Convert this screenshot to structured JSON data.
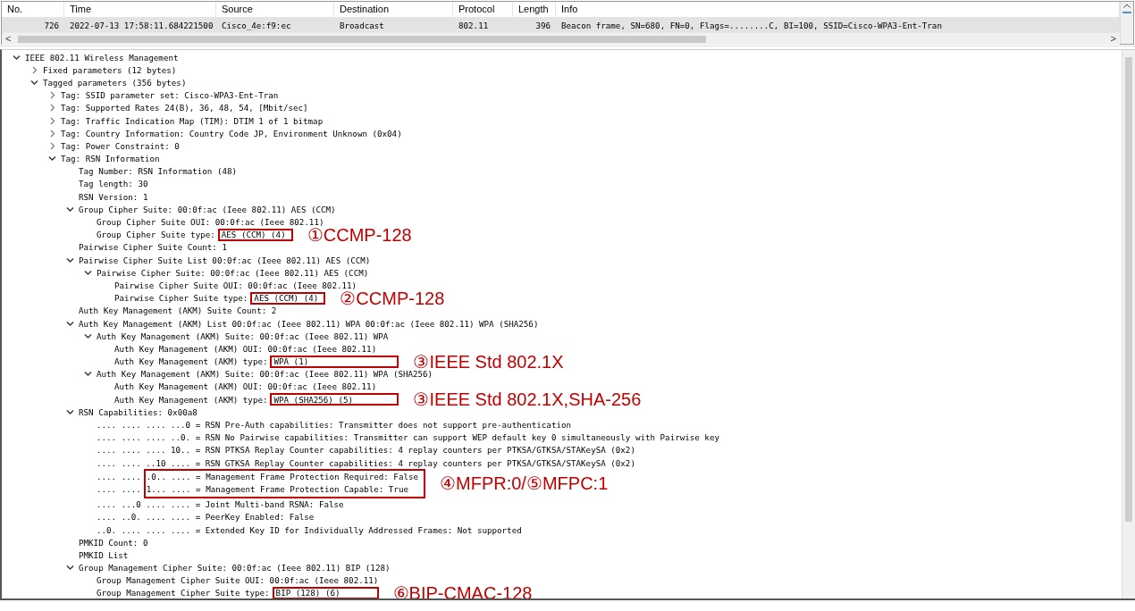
{
  "packet_list": {
    "columns": [
      "No.",
      "Time",
      "Source",
      "Destination",
      "Protocol",
      "Length",
      "Info"
    ],
    "rows": [
      {
        "selected": true,
        "cells": [
          "726",
          "2022-07-13 17:58:11.684221500",
          "Cisco_4e:f9:ec",
          "Broadcast",
          "802.11",
          "396",
          "Beacon frame, SN=680, FN=0, Flags=........C, BI=100, SSID=Cisco-WPA3-Ent-Tran"
        ]
      }
    ]
  },
  "scroll_left": "<",
  "scroll_right": ">",
  "tree": [
    {
      "text": "IEEE 802.11 Wireless Management",
      "expanded": true,
      "children": [
        {
          "text": "Fixed parameters (12 bytes)",
          "expanded": false
        },
        {
          "text": "Tagged parameters (356 bytes)",
          "expanded": true,
          "children": [
            {
              "text": "Tag: SSID parameter set: Cisco-WPA3-Ent-Tran",
              "expanded": false
            },
            {
              "text": "Tag: Supported Rates 24(B), 36, 48, 54, [Mbit/sec]",
              "expanded": false
            },
            {
              "text": "Tag: Traffic Indication Map (TIM): DTIM 1 of 1 bitmap",
              "expanded": false
            },
            {
              "text": "Tag: Country Information: Country Code JP, Environment Unknown (0x04)",
              "expanded": false
            },
            {
              "text": "Tag: Power Constraint: 0",
              "expanded": false
            },
            {
              "text": "Tag: RSN Information",
              "expanded": true,
              "children": [
                {
                  "text": "Tag Number: RSN Information (48)"
                },
                {
                  "text": "Tag length: 30"
                },
                {
                  "text": "RSN Version: 1"
                },
                {
                  "text": "Group Cipher Suite: 00:0f:ac (Ieee 802.11) AES (CCM)",
                  "expanded": true,
                  "children": [
                    {
                      "text": "Group Cipher Suite OUI: 00:0f:ac (Ieee 802.11)"
                    },
                    {
                      "kind": "marked",
                      "text": "Group Cipher Suite type:",
                      "boxed": "AES (CCM) (4)",
                      "note": "①CCMP-128"
                    }
                  ]
                },
                {
                  "text": "Pairwise Cipher Suite Count: 1"
                },
                {
                  "text": "Pairwise Cipher Suite List 00:0f:ac (Ieee 802.11) AES (CCM)",
                  "expanded": true,
                  "children": [
                    {
                      "text": "Pairwise Cipher Suite: 00:0f:ac (Ieee 802.11) AES (CCM)",
                      "expanded": true,
                      "children": [
                        {
                          "text": "Pairwise Cipher Suite OUI: 00:0f:ac (Ieee 802.11)"
                        },
                        {
                          "kind": "marked",
                          "text": "Pairwise Cipher Suite type:",
                          "boxed": "AES (CCM) (4)",
                          "note": "②CCMP-128"
                        }
                      ]
                    }
                  ]
                },
                {
                  "text": "Auth Key Management (AKM) Suite Count: 2"
                },
                {
                  "text": "Auth Key Management (AKM) List 00:0f:ac (Ieee 802.11) WPA 00:0f:ac (Ieee 802.11) WPA (SHA256)",
                  "expanded": true,
                  "children": [
                    {
                      "text": "Auth Key Management (AKM) Suite: 00:0f:ac (Ieee 802.11) WPA",
                      "expanded": true,
                      "children": [
                        {
                          "text": "Auth Key Management (AKM) OUI: 00:0f:ac (Ieee 802.11)"
                        },
                        {
                          "kind": "marked",
                          "text": "Auth Key Management (AKM) type:",
                          "boxed": "WPA (1)",
                          "note": "③IEEE Std 802.1X"
                        }
                      ]
                    },
                    {
                      "text": "Auth Key Management (AKM) Suite: 00:0f:ac (Ieee 802.11) WPA (SHA256)",
                      "expanded": true,
                      "children": [
                        {
                          "text": "Auth Key Management (AKM) OUI: 00:0f:ac (Ieee 802.11)"
                        },
                        {
                          "kind": "marked",
                          "text": "Auth Key Management (AKM) type:",
                          "boxed": "WPA (SHA256) (5)",
                          "note": "③IEEE Std 802.1X,SHA-256"
                        }
                      ]
                    }
                  ]
                },
                {
                  "text": "RSN Capabilities: 0x00a8",
                  "expanded": true,
                  "children": [
                    {
                      "text": ".... .... .... ...0 = RSN Pre-Auth capabilities: Transmitter does not support pre-authentication"
                    },
                    {
                      "text": ".... .... .... ..0. = RSN No Pairwise capabilities: Transmitter can support WEP default key 0 simultaneously with Pairwise key"
                    },
                    {
                      "text": ".... .... .... 10.. = RSN PTKSA Replay Counter capabilities: 4 replay counters per PTKSA/GTKSA/STAKeySA (0x2)"
                    },
                    {
                      "text": ".... .... ..10 .... = RSN GTKSA Replay Counter capabilities: 4 replay counters per PTKSA/GTKSA/STAKeySA (0x2)"
                    },
                    {
                      "kind": "marked_group",
                      "note": "④MFPR:0/⑤MFPC:1",
                      "rows": [
                        {
                          "prefix": ".... ....",
                          "boxed": ".0.. .... = Management Frame Protection Required: False"
                        },
                        {
                          "prefix": ".... ....",
                          "boxed": "1... .... = Management Frame Protection Capable: True"
                        }
                      ]
                    },
                    {
                      "text": ".... ...0 .... .... = Joint Multi-band RSNA: False"
                    },
                    {
                      "text": ".... ..0. .... .... = PeerKey Enabled: False"
                    },
                    {
                      "text": "..0. .... .... .... = Extended Key ID for Individually Addressed Frames: Not supported"
                    }
                  ]
                },
                {
                  "text": "PMKID Count: 0"
                },
                {
                  "text": "PMKID List"
                },
                {
                  "text": "Group Management Cipher Suite: 00:0f:ac (Ieee 802.11) BIP (128)",
                  "expanded": true,
                  "children": [
                    {
                      "text": "Group Management Cipher Suite OUI: 00:0f:ac (Ieee 802.11)"
                    },
                    {
                      "kind": "marked",
                      "text": "Group Management Cipher Suite type:",
                      "boxed": "BIP (128) (6)",
                      "note": "⑥BIP-CMAC-128"
                    }
                  ]
                }
              ]
            }
          ]
        }
      ]
    }
  ]
}
